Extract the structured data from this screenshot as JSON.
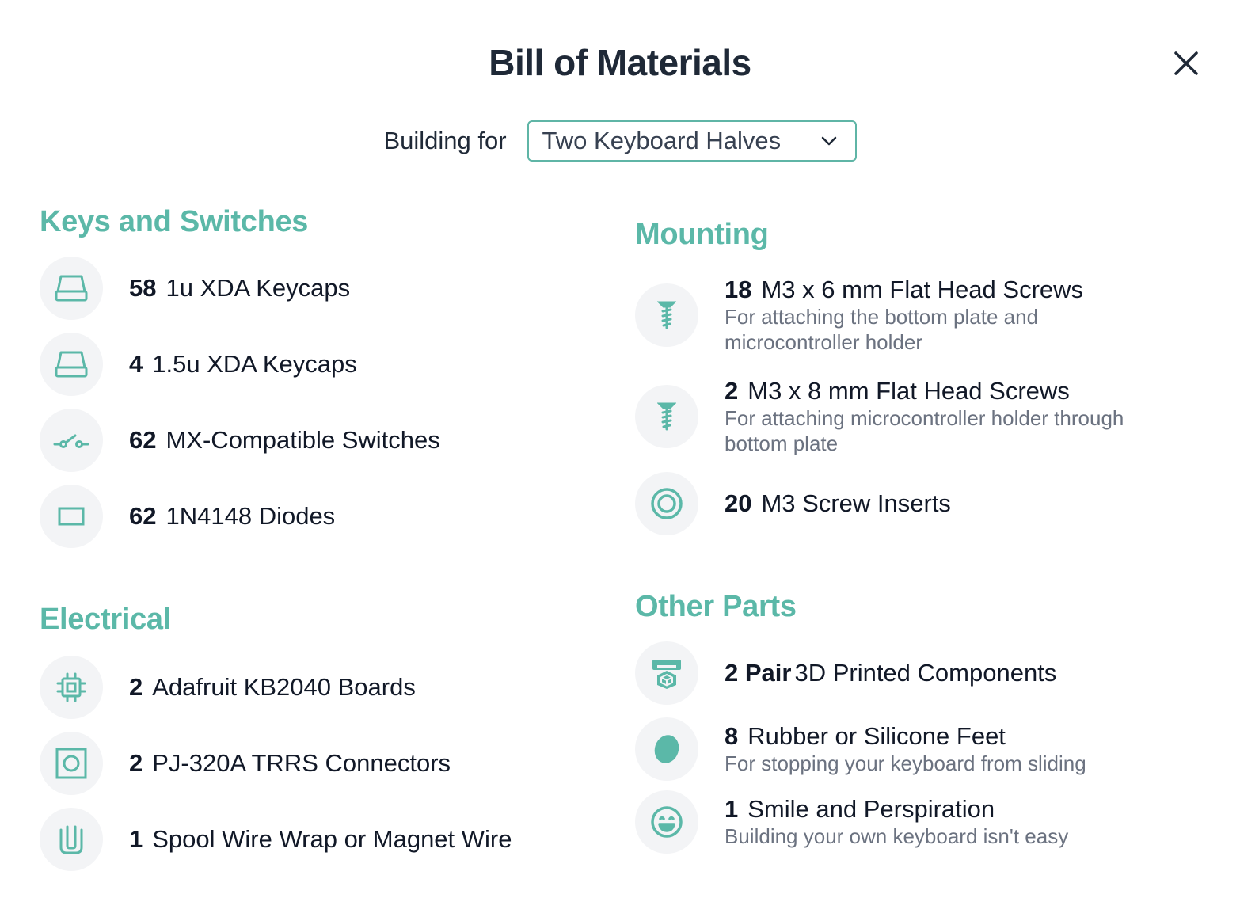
{
  "header": {
    "title": "Bill of Materials",
    "close_icon": "close-icon"
  },
  "building": {
    "label": "Building for",
    "selected": "Two Keyboard Halves"
  },
  "colors": {
    "accent": "#5bb8a8",
    "icon_bg": "#f3f4f6",
    "text": "#111827",
    "muted": "#6b7280"
  },
  "sections": {
    "keys": {
      "title": "Keys and Switches",
      "items": [
        {
          "qty": "58",
          "name": "1u XDA Keycaps",
          "icon": "keycap-icon"
        },
        {
          "qty": "4",
          "name": "1.5u XDA Keycaps",
          "icon": "keycap-icon"
        },
        {
          "qty": "62",
          "name": "MX-Compatible Switches",
          "icon": "switch-icon"
        },
        {
          "qty": "62",
          "name": "1N4148 Diodes",
          "icon": "diode-icon"
        }
      ]
    },
    "electrical": {
      "title": "Electrical",
      "items": [
        {
          "qty": "2",
          "name": "Adafruit KB2040 Boards",
          "icon": "chip-icon"
        },
        {
          "qty": "2",
          "name": "PJ-320A TRRS Connectors",
          "icon": "connector-icon"
        },
        {
          "qty": "1",
          "name": "Spool Wire Wrap or Magnet Wire",
          "icon": "wire-icon"
        }
      ]
    },
    "mounting": {
      "title": "Mounting",
      "items": [
        {
          "qty": "18",
          "name": "M3 x 6 mm Flat Head Screws",
          "desc1": "For attaching the bottom plate and",
          "desc2": "microcontroller holder",
          "icon": "screw-icon"
        },
        {
          "qty": "2",
          "name": "M3 x 8 mm Flat Head Screws",
          "desc1": "For attaching microcontroller holder through",
          "desc2": "bottom plate",
          "icon": "screw-icon"
        },
        {
          "qty": "20",
          "name": "M3 Screw Inserts",
          "icon": "insert-icon"
        }
      ]
    },
    "other": {
      "title": "Other Parts",
      "items": [
        {
          "qty": "2 Pair",
          "name": "3D Printed Components",
          "icon": "printer-icon"
        },
        {
          "qty": "8",
          "name": "Rubber or Silicone Feet",
          "desc1": "For stopping your keyboard from sliding",
          "icon": "foot-icon"
        },
        {
          "qty": "1",
          "name": "Smile and Perspiration",
          "desc1": "Building your own keyboard isn't easy",
          "icon": "smile-icon"
        }
      ]
    }
  }
}
